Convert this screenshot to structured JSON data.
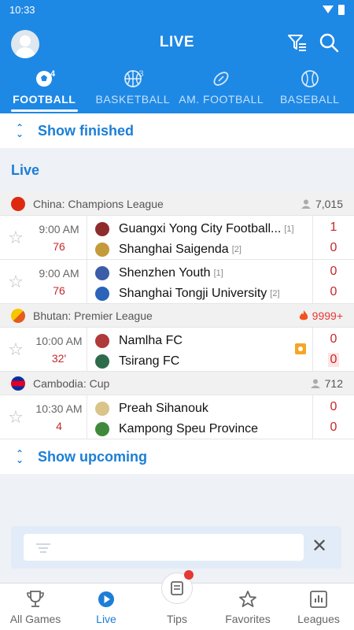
{
  "status": {
    "time": "10:33"
  },
  "header": {
    "title": "LIVE"
  },
  "tabs": [
    {
      "label": "FOOTBALL",
      "count": "4",
      "icon": "soccer-ball-icon",
      "active": true
    },
    {
      "label": "BASKETBALL",
      "count": "3",
      "icon": "basketball-icon",
      "active": false
    },
    {
      "label": "AM. FOOTBALL",
      "count": "",
      "icon": "american-football-icon",
      "active": false
    },
    {
      "label": "BASEBALL",
      "count": "",
      "icon": "baseball-icon",
      "active": false
    }
  ],
  "show_finished": "Show finished",
  "section_title": "Live",
  "leagues": [
    {
      "name": "China: Champions League",
      "followers": "7,015",
      "hot": false,
      "matches": [
        {
          "time": "9:00 AM",
          "minute": "76",
          "home": "Guangxi Yong City Football...",
          "home_rank": "[1]",
          "away": "Shanghai Saigenda",
          "away_rank": "[2]",
          "home_score": "1",
          "away_score": "0"
        },
        {
          "time": "9:00 AM",
          "minute": "76",
          "home": "Shenzhen Youth",
          "home_rank": "[1]",
          "away": "Shanghai Tongji University",
          "away_rank": "[2]",
          "home_score": "0",
          "away_score": "0"
        }
      ]
    },
    {
      "name": "Bhutan: Premier League",
      "followers": "9999+",
      "hot": true,
      "matches": [
        {
          "time": "10:00 AM",
          "minute": "32'",
          "home": "Namlha FC",
          "home_rank": "",
          "away": "Tsirang FC",
          "away_rank": "",
          "home_score": "0",
          "away_score": "0"
        }
      ]
    },
    {
      "name": "Cambodia: Cup",
      "followers": "712",
      "hot": false,
      "matches": [
        {
          "time": "10:30 AM",
          "minute": "4",
          "home": "Preah Sihanouk",
          "home_rank": "",
          "away": "Kampong Speu Province",
          "away_rank": "",
          "home_score": "0",
          "away_score": "0"
        }
      ]
    }
  ],
  "show_upcoming": "Show upcoming",
  "bottom_nav": [
    {
      "label": "All Games",
      "icon": "trophy-icon"
    },
    {
      "label": "Live",
      "icon": "play-icon"
    },
    {
      "label": "Tips",
      "icon": "tips-icon"
    },
    {
      "label": "Favorites",
      "icon": "star-icon"
    },
    {
      "label": "Leagues",
      "icon": "leagues-icon"
    }
  ],
  "colors": {
    "primary": "#1e88e5",
    "accent_text": "#1c7ed6",
    "live_red": "#c62828"
  }
}
